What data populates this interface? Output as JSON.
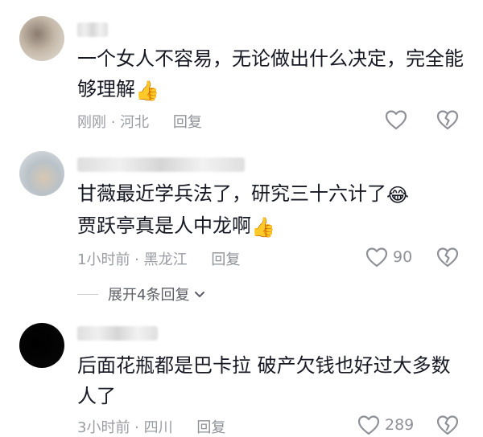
{
  "comments": [
    {
      "text": "一个女人不容易，无论做出什么决定，完全能够理解",
      "emoji": "👍",
      "time": "刚刚",
      "location": "河北",
      "reply_label": "回复",
      "like_count": ""
    },
    {
      "text": "甘薇最近学兵法了，研究三十六计了",
      "emoji": "😂",
      "text2": "贾跃亭真是人中龙啊",
      "emoji2": "👍",
      "time": "1小时前",
      "location": "黑龙江",
      "reply_label": "回复",
      "like_count": "90",
      "expand_label": "展开4条回复"
    },
    {
      "text": "后面花瓶都是巴卡拉 破产欠钱也好过大多数人了",
      "time": "3小时前",
      "location": "四川",
      "reply_label": "回复",
      "like_count": "289"
    }
  ],
  "separator": " · ",
  "colors": {
    "text": "#161823",
    "meta": "#9a9ca3",
    "icon": "#8f9198"
  },
  "icons": {
    "like": "heart-outline-icon",
    "dislike": "broken-heart-icon",
    "expand": "chevron-down-icon"
  }
}
